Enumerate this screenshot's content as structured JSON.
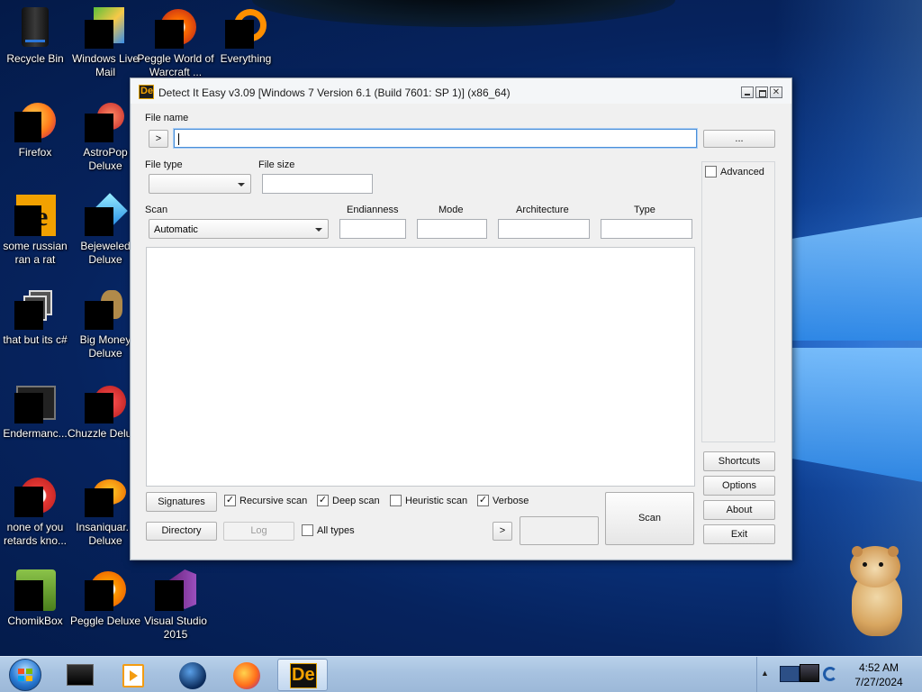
{
  "desktop": {
    "icons": [
      {
        "label": "Recycle Bin",
        "icon": "recycle-bin-icon"
      },
      {
        "label": "Windows Live Mail",
        "icon": "windows-live-mail-icon"
      },
      {
        "label": "Peggle World of Warcraft ...",
        "icon": "peggle-wow-icon"
      },
      {
        "label": "Everything",
        "icon": "everything-search-icon"
      },
      {
        "label": "Firefox",
        "icon": "firefox-icon"
      },
      {
        "label": "AstroPop Deluxe",
        "icon": "astropop-icon"
      },
      {
        "label": "some russian ran a rat",
        "icon": "detect-it-easy-icon"
      },
      {
        "label": "Bejeweled Deluxe",
        "icon": "bejeweled-icon"
      },
      {
        "label": "that but its c#",
        "icon": "folder-shortcut-icon"
      },
      {
        "label": "Big Money Deluxe",
        "icon": "big-money-icon"
      },
      {
        "label": "Endermanc...",
        "icon": "endermanch-icon"
      },
      {
        "label": "Chuzzle Deluxe",
        "icon": "chuzzle-icon"
      },
      {
        "label": "none of you retards kno...",
        "icon": "peggle-icon"
      },
      {
        "label": "Insaniquar... Deluxe",
        "icon": "insaniquarium-icon"
      },
      {
        "label": "ChomikBox",
        "icon": "chomikbox-icon"
      },
      {
        "label": "Peggle Deluxe",
        "icon": "peggle-deluxe-icon"
      },
      {
        "label": "Visual Studio 2015",
        "icon": "visual-studio-icon"
      }
    ]
  },
  "window": {
    "title": "Detect It Easy v3.09 [Windows 7 Version 6.1 (Build 7601: SP 1)] (x86_64)",
    "app_icon_text": "De",
    "file_name_label": "File name",
    "file_name_value": "",
    "open_arrow_label": ">",
    "browse_label": "...",
    "file_type_label": "File type",
    "file_type_value": "",
    "file_size_label": "File size",
    "file_size_value": "",
    "scan_label": "Scan",
    "scan_mode_value": "Automatic",
    "endianness_label": "Endianness",
    "mode_label": "Mode",
    "architecture_label": "Architecture",
    "type_label": "Type",
    "endianness_value": "",
    "mode_value": "",
    "architecture_value": "",
    "type_value": "",
    "advanced_label": "Advanced",
    "advanced_checked": false,
    "side_buttons": [
      "Shortcuts",
      "Options",
      "About",
      "Exit"
    ],
    "signatures_label": "Signatures",
    "directory_label": "Directory",
    "log_label": "Log",
    "recursive_scan_label": "Recursive scan",
    "recursive_scan_checked": true,
    "deep_scan_label": "Deep scan",
    "deep_scan_checked": true,
    "heuristic_scan_label": "Heuristic scan",
    "heuristic_scan_checked": false,
    "verbose_label": "Verbose",
    "verbose_checked": true,
    "all_types_label": "All types",
    "all_types_checked": false,
    "next_arrow_label": ">",
    "scan_button_label": "Scan",
    "check_mark": "✓"
  },
  "taskbar": {
    "start_icon": "windows-start-orb-icon",
    "pinned": [
      "terminal-icon",
      "media-player-icon",
      "network-globe-icon",
      "firefox-icon",
      "detect-it-easy-icon"
    ],
    "active_index": 4,
    "active_text": "De",
    "tray": {
      "arrow": "▲",
      "time": "4:52 AM",
      "date": "7/27/2024"
    }
  }
}
